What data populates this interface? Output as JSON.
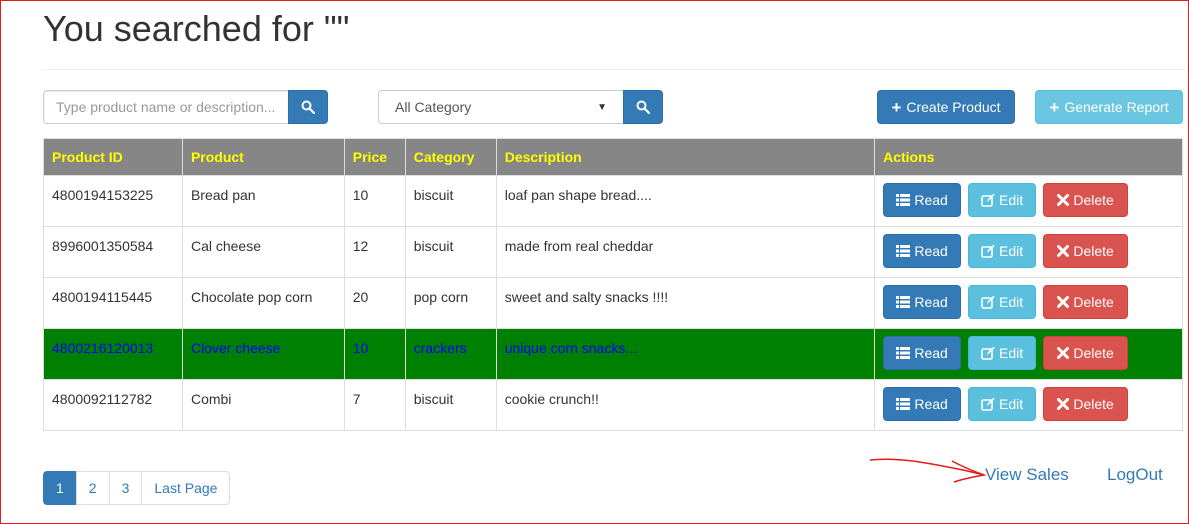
{
  "page": {
    "title": "You searched for \"\""
  },
  "search": {
    "placeholder": "Type product name or description...",
    "value": ""
  },
  "category_filter": {
    "selected": "All Category"
  },
  "toolbar": {
    "create_label": "Create Product",
    "report_label": "Generate Report"
  },
  "table": {
    "headers": [
      "Product ID",
      "Product",
      "Price",
      "Category",
      "Description",
      "Actions"
    ],
    "action_labels": {
      "read": "Read",
      "edit": "Edit",
      "delete": "Delete"
    },
    "rows": [
      {
        "id": "4800194153225",
        "product": "Bread pan",
        "price": "10",
        "category": "biscuit",
        "description": "loaf pan shape bread...."
      },
      {
        "id": "8996001350584",
        "product": "Cal cheese",
        "price": "12",
        "category": "biscuit",
        "description": "made from real cheddar"
      },
      {
        "id": "4800194115445",
        "product": "Chocolate pop corn",
        "price": "20",
        "category": "pop corn",
        "description": "sweet and salty snacks !!!!"
      },
      {
        "id": "4800216120013",
        "product": "Clover cheese",
        "price": "10",
        "category": "crackers",
        "description": "unique corn snacks..."
      },
      {
        "id": "4800092112782",
        "product": "Combi",
        "price": "7",
        "category": "biscuit",
        "description": "cookie crunch!!"
      }
    ],
    "highlight_color": "#008000"
  },
  "pagination": {
    "pages": [
      "1",
      "2",
      "3"
    ],
    "active": "1",
    "last_label": "Last Page"
  },
  "footer_links": {
    "view_sales": "View Sales",
    "logout": "LogOut"
  },
  "colors": {
    "primary": "#337ab7",
    "info": "#5bc0de",
    "danger": "#d9534f",
    "header_bg": "#868686",
    "header_text": "#ffff00"
  }
}
